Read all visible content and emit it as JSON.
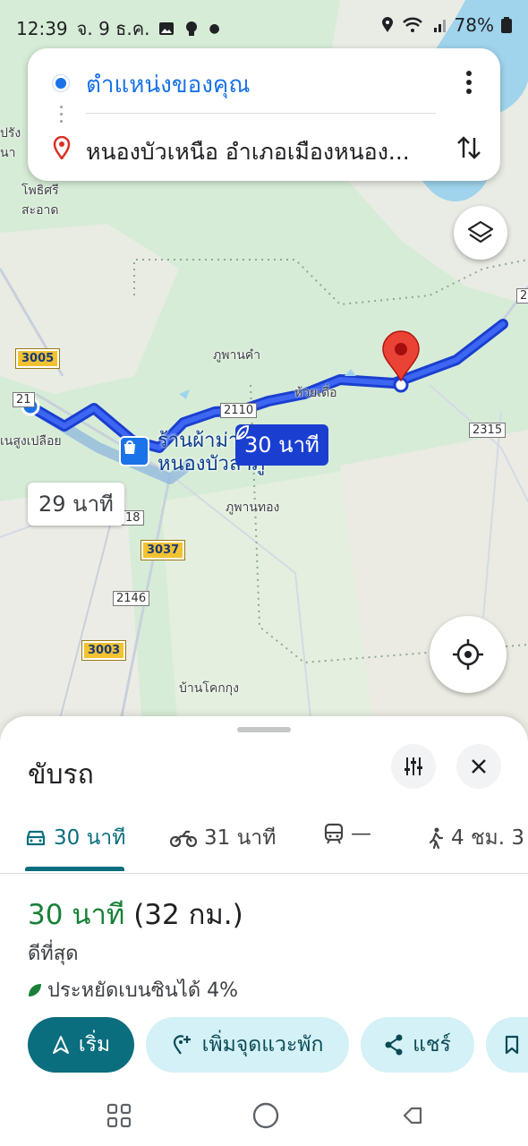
{
  "status_bar": {
    "time": "12:39",
    "date": "จ. 9 ธ.ค.",
    "battery": "78%"
  },
  "route_card": {
    "origin": "ตำแหน่งของคุณ",
    "destination": "หนองบัวเหนือ อำเภอเมืองหนอง..."
  },
  "map": {
    "places": {
      "phupan_kham": "ภูพานคำ",
      "huai_duea": "ห้วยเดื่อ",
      "phupan_thong": "ภูพานทอง",
      "ban_khok_kung": "บ้านโคกกุง",
      "pho_si_sa_at": "โพธิศรี\nสะอาด",
      "non_sung": "เนสูงเปลือย",
      "prong": "ปรัง\nนา"
    },
    "highways": {
      "h3005": "3005",
      "h3037": "3037",
      "h3003": "3003"
    },
    "roads": {
      "r2110": "2110",
      "r2315": "2315",
      "r2146": "2146",
      "r18": "18",
      "r21": "21",
      "r2": "2"
    },
    "shop_label": "ร้านผ้าม่าน\nหนองบัวลำภู",
    "time_main": "30 นาที",
    "time_alt": "29 นาที"
  },
  "sheet": {
    "title": "ขับรถ",
    "tabs": [
      {
        "label": "30 นาที",
        "icon": "car-icon"
      },
      {
        "label": "31 นาที",
        "icon": "motorcycle-icon"
      },
      {
        "label": "—",
        "icon": "train-icon"
      },
      {
        "label": "4 ชม. 3",
        "icon": "walk-icon"
      }
    ],
    "summary_time": "30 นาที",
    "summary_distance": " (32 กม.)",
    "best": "ดีที่สุด",
    "eco": "ประหยัดเบนซินได้ 4%",
    "buttons": {
      "start": "เริ่ม",
      "add_stop": "เพิ่มจุดแวะพัก",
      "share": "แชร์"
    }
  },
  "colors": {
    "accent": "#0b6e7e",
    "route": "#1a3fd0",
    "green_time": "#188038"
  }
}
